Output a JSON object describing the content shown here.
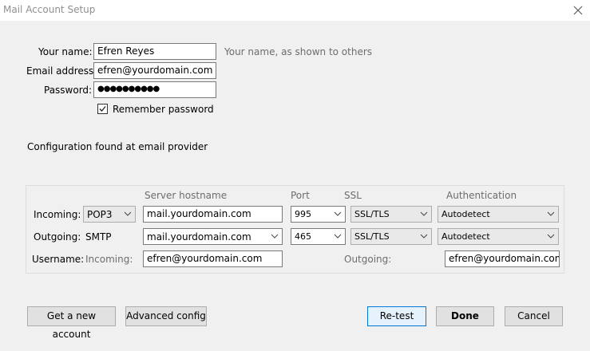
{
  "window": {
    "title": "Mail Account Setup"
  },
  "form": {
    "name_label": "Your name:",
    "name_value": "Efren Reyes",
    "name_hint": "Your name, as shown to others",
    "email_label": "Email address:",
    "email_value": "efren@yourdomain.com",
    "password_label": "Password:",
    "password_value": "●●●●●●●●●●",
    "remember_label": "Remember password",
    "remember_checked": true
  },
  "status": "Configuration found at email provider",
  "server": {
    "headers": {
      "hostname": "Server hostname",
      "port": "Port",
      "ssl": "SSL",
      "auth": "Authentication"
    },
    "incoming": {
      "label": "Incoming:",
      "protocol": "POP3",
      "hostname": "mail.yourdomain.com",
      "port": "995",
      "ssl": "SSL/TLS",
      "auth": "Autodetect"
    },
    "outgoing": {
      "label": "Outgoing:",
      "protocol": "SMTP",
      "hostname": "mail.yourdomain.com",
      "port": "465",
      "ssl": "SSL/TLS",
      "auth": "Autodetect"
    },
    "username": {
      "label": "Username:",
      "incoming_label": "Incoming:",
      "incoming_value": "efren@yourdomain.com",
      "outgoing_label": "Outgoing:",
      "outgoing_value": "efren@yourdomain.com"
    }
  },
  "buttons": {
    "new_account": "Get a new account",
    "advanced": "Advanced config",
    "retest": "Re-test",
    "done": "Done",
    "cancel": "Cancel"
  },
  "icons": {
    "close": "close-icon",
    "check": "check-icon",
    "dropdown": "chevron-down-icon"
  }
}
